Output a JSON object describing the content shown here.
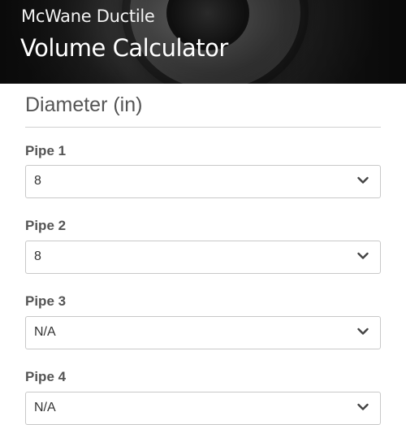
{
  "header": {
    "company": "McWane Ductile",
    "title": "Volume Calculator"
  },
  "section": {
    "title": "Diameter (in)"
  },
  "pipes": [
    {
      "label": "Pipe 1",
      "value": "8"
    },
    {
      "label": "Pipe 2",
      "value": "8"
    },
    {
      "label": "Pipe 3",
      "value": "N/A"
    },
    {
      "label": "Pipe 4",
      "value": "N/A"
    }
  ],
  "icons": {
    "dropdown": "chevron-down-icon"
  },
  "colors": {
    "label": "#555555",
    "border": "#c8c8c8",
    "header_bg": "#1e1e1e"
  }
}
